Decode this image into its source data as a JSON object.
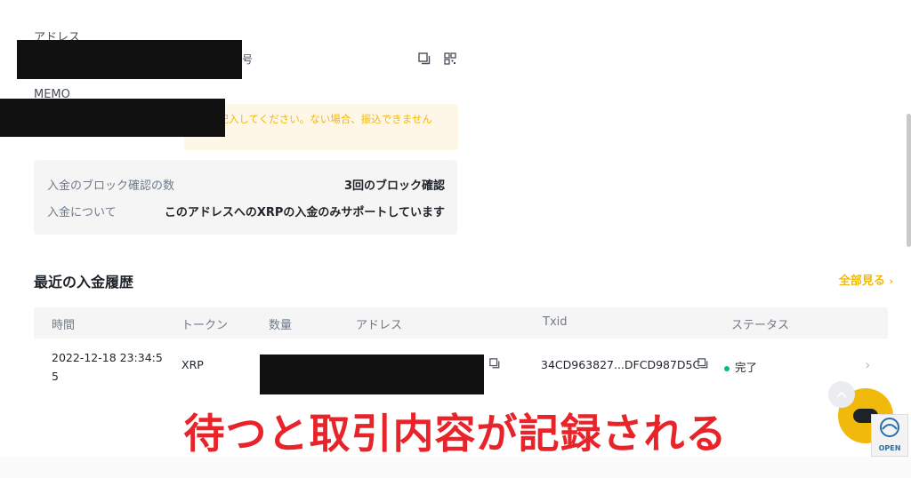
{
  "address": {
    "label": "アドレス",
    "copy_icon": "copy-icon",
    "qr_icon": "qr-code-icon"
  },
  "memo": {
    "label": "MEMO",
    "warning": "MOを記入してください。ない場合、振込できません"
  },
  "info": {
    "rows": [
      {
        "key": "入金のブロック確認の数",
        "value": "3回のブロック確認"
      },
      {
        "key": "入金について",
        "value": "このアドレスへのXRPの入金のみサポートしています"
      }
    ]
  },
  "history": {
    "title": "最近の入金履歴",
    "view_all": "全部見る",
    "columns": [
      "時間",
      "トークン",
      "数量",
      "アドレス",
      "Txid",
      "ステータス"
    ],
    "rows": [
      {
        "time_line1": "2022-12-18 23:34:5",
        "time_line2": "5",
        "token": "XRP",
        "txid": "34CD963827...DFCD987D5C",
        "status": "完了"
      }
    ]
  },
  "caption": "待つと取引内容が記録される",
  "badge": {
    "label": "OPEN"
  },
  "colors": {
    "accent": "#f0b90b",
    "caption": "#e8242a",
    "success": "#02c076"
  }
}
